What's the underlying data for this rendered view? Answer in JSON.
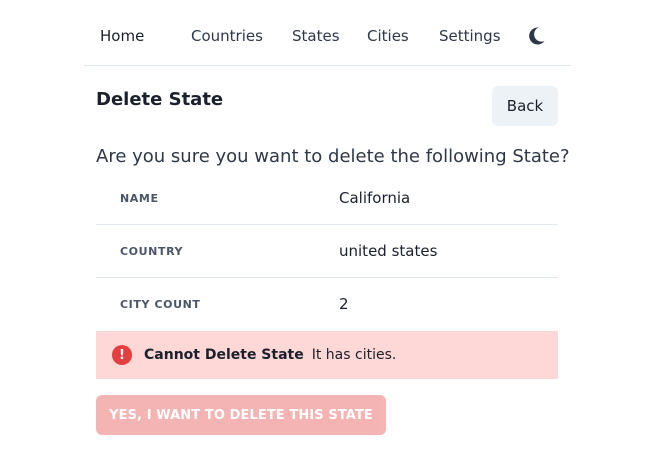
{
  "nav": {
    "items": [
      {
        "label": "Home"
      },
      {
        "label": "Countries"
      },
      {
        "label": "States"
      },
      {
        "label": "Cities"
      },
      {
        "label": "Settings"
      }
    ],
    "theme_icon": "moon-icon"
  },
  "header": {
    "title": "Delete State",
    "back_label": "Back"
  },
  "question": "Are you sure you want to delete the following State?",
  "details": [
    {
      "label": "NAME",
      "value": "California"
    },
    {
      "label": "COUNTRY",
      "value": "united states"
    },
    {
      "label": "CITY COUNT",
      "value": "2"
    }
  ],
  "alert": {
    "icon": "exclamation-circle-icon",
    "title": "Cannot Delete State",
    "description": "It has cities.",
    "color": "#fed7d7",
    "icon_color": "#e53e3e"
  },
  "delete_button": {
    "label": "YES, I WANT TO DELETE THIS STATE",
    "disabled": true,
    "color": "#f5b0b0"
  }
}
